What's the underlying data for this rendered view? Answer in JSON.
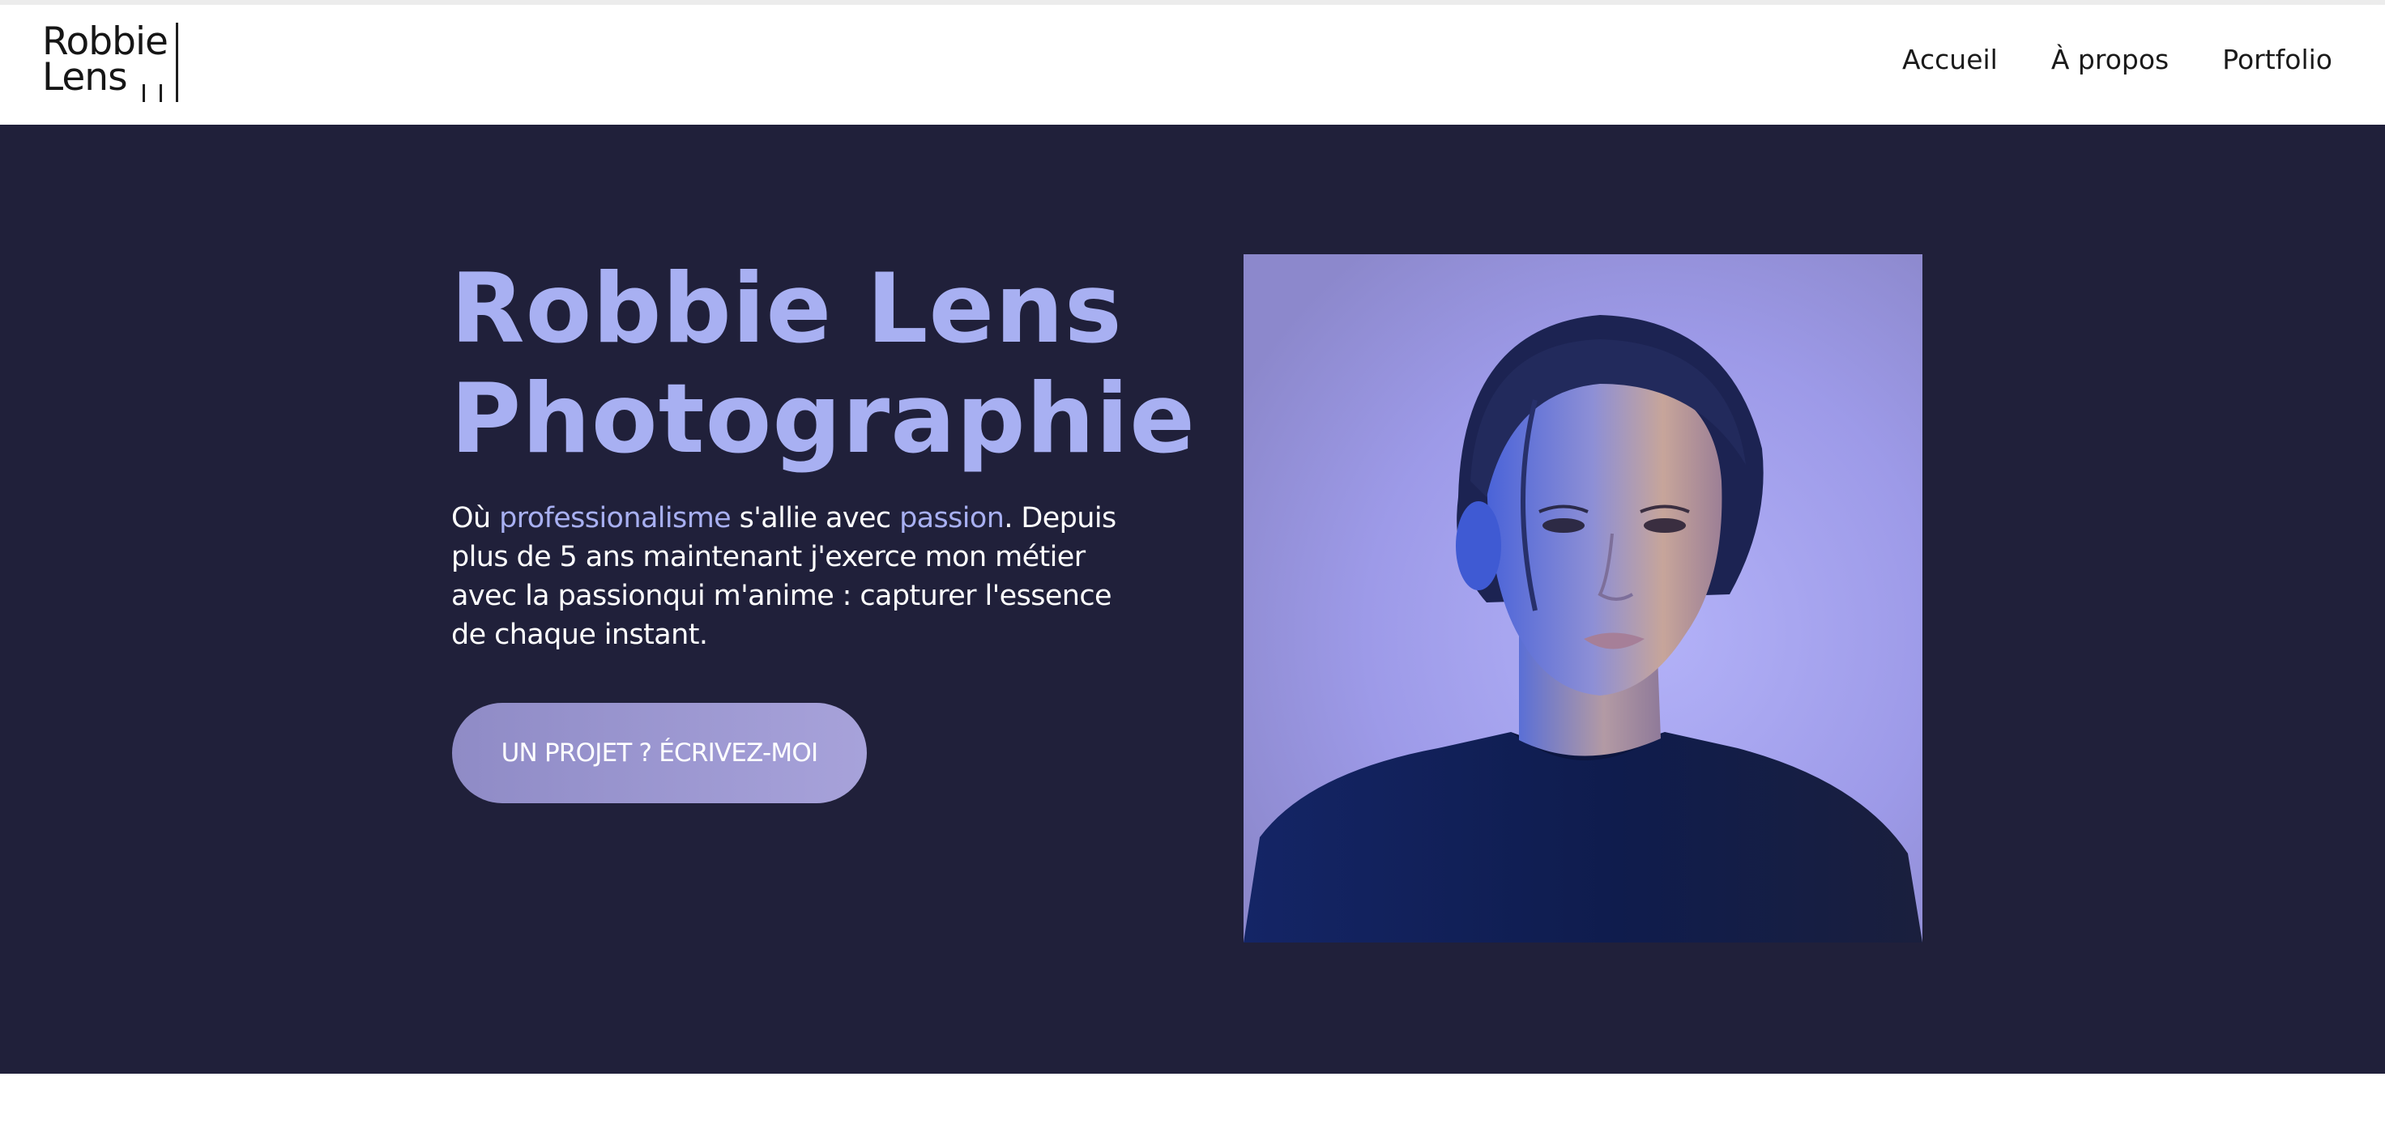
{
  "logo": {
    "line1": "Robbie",
    "line2": "Lens"
  },
  "nav": {
    "items": [
      {
        "label": "Accueil"
      },
      {
        "label": "À propos"
      },
      {
        "label": "Portfolio"
      }
    ]
  },
  "hero": {
    "title_line1": "Robbie Lens",
    "title_line2": "Photographie",
    "text": {
      "part1": "Où ",
      "highlight1": "professionalisme",
      "part2": " s'allie avec ",
      "highlight2": "passion",
      "part3": ". Depuis plus de 5 ans maintenant j'exerce mon métier avec la passionqui m'anime : capturer l'essence de chaque instant."
    },
    "cta_label": "UN PROJET ? ÉCRIVEZ-MOI"
  },
  "colors": {
    "hero_background": "#20203a",
    "accent": "#a8b0f2",
    "cta_gradient_start": "#8f8bc6",
    "cta_gradient_end": "#a7a2da"
  }
}
